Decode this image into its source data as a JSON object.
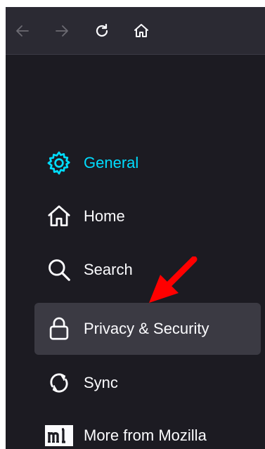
{
  "toolbar": {
    "buttons": [
      {
        "name": "back",
        "icon": "back-arrow-icon",
        "enabled": false
      },
      {
        "name": "forward",
        "icon": "forward-arrow-icon",
        "enabled": false
      },
      {
        "name": "reload",
        "icon": "reload-icon",
        "enabled": true
      },
      {
        "name": "home",
        "icon": "home-icon",
        "enabled": true
      }
    ]
  },
  "sidebar": {
    "items": [
      {
        "label": "General",
        "icon": "gear-icon",
        "active": true
      },
      {
        "label": "Home",
        "icon": "home-icon"
      },
      {
        "label": "Search",
        "icon": "search-icon"
      },
      {
        "label": "Privacy & Security",
        "icon": "lock-icon",
        "selected": true
      },
      {
        "label": "Sync",
        "icon": "sync-icon"
      },
      {
        "label": "More from Mozilla",
        "icon": "mozilla-m-icon"
      }
    ]
  },
  "annotation": {
    "icon": "red-arrow-icon",
    "color": "#ff0000"
  },
  "colors": {
    "background": "#1c1b22",
    "toolbar": "#2b2a33",
    "accent": "#00ddff",
    "selected": "#3b3a43",
    "text": "#fbfbfe",
    "disabled": "#6c6b73"
  }
}
